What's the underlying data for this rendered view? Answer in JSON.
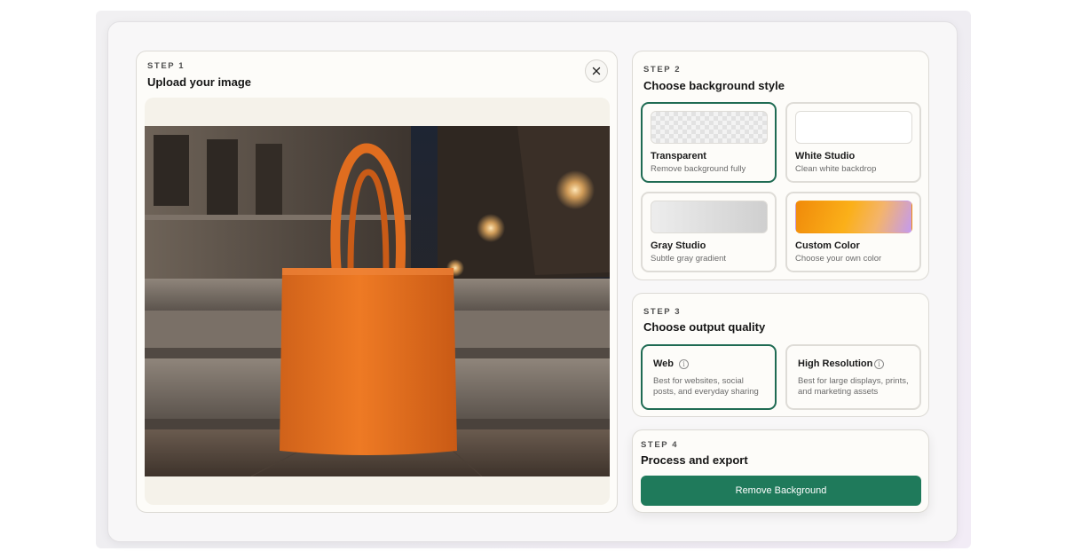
{
  "step1": {
    "label": "STEP 1",
    "title": "Upload your image"
  },
  "step2": {
    "label": "STEP 2",
    "title": "Choose background style",
    "options": [
      {
        "name": "Transparent",
        "desc": "Remove background fully",
        "selected": true
      },
      {
        "name": "White Studio",
        "desc": "Clean white backdrop",
        "selected": false
      },
      {
        "name": "Gray Studio",
        "desc": "Subtle gray gradient",
        "selected": false
      },
      {
        "name": "Custom Color",
        "desc": "Choose your own color",
        "selected": false
      }
    ]
  },
  "step3": {
    "label": "STEP 3",
    "title": "Choose output quality",
    "options": [
      {
        "name": "Web",
        "desc": "Best for websites, social posts, and everyday sharing",
        "selected": true
      },
      {
        "name": "High Resolution",
        "desc": "Best for large displays, prints, and marketing assets",
        "selected": false
      }
    ]
  },
  "step4": {
    "label": "STEP 4",
    "title": "Process and export",
    "button_label": "Remove Background"
  },
  "icons": {
    "close": "close-icon",
    "info": "info-icon"
  },
  "colors": {
    "accent": "#1f7a5b",
    "selected_border": "#1f6b53",
    "bag": "#e8711d"
  }
}
